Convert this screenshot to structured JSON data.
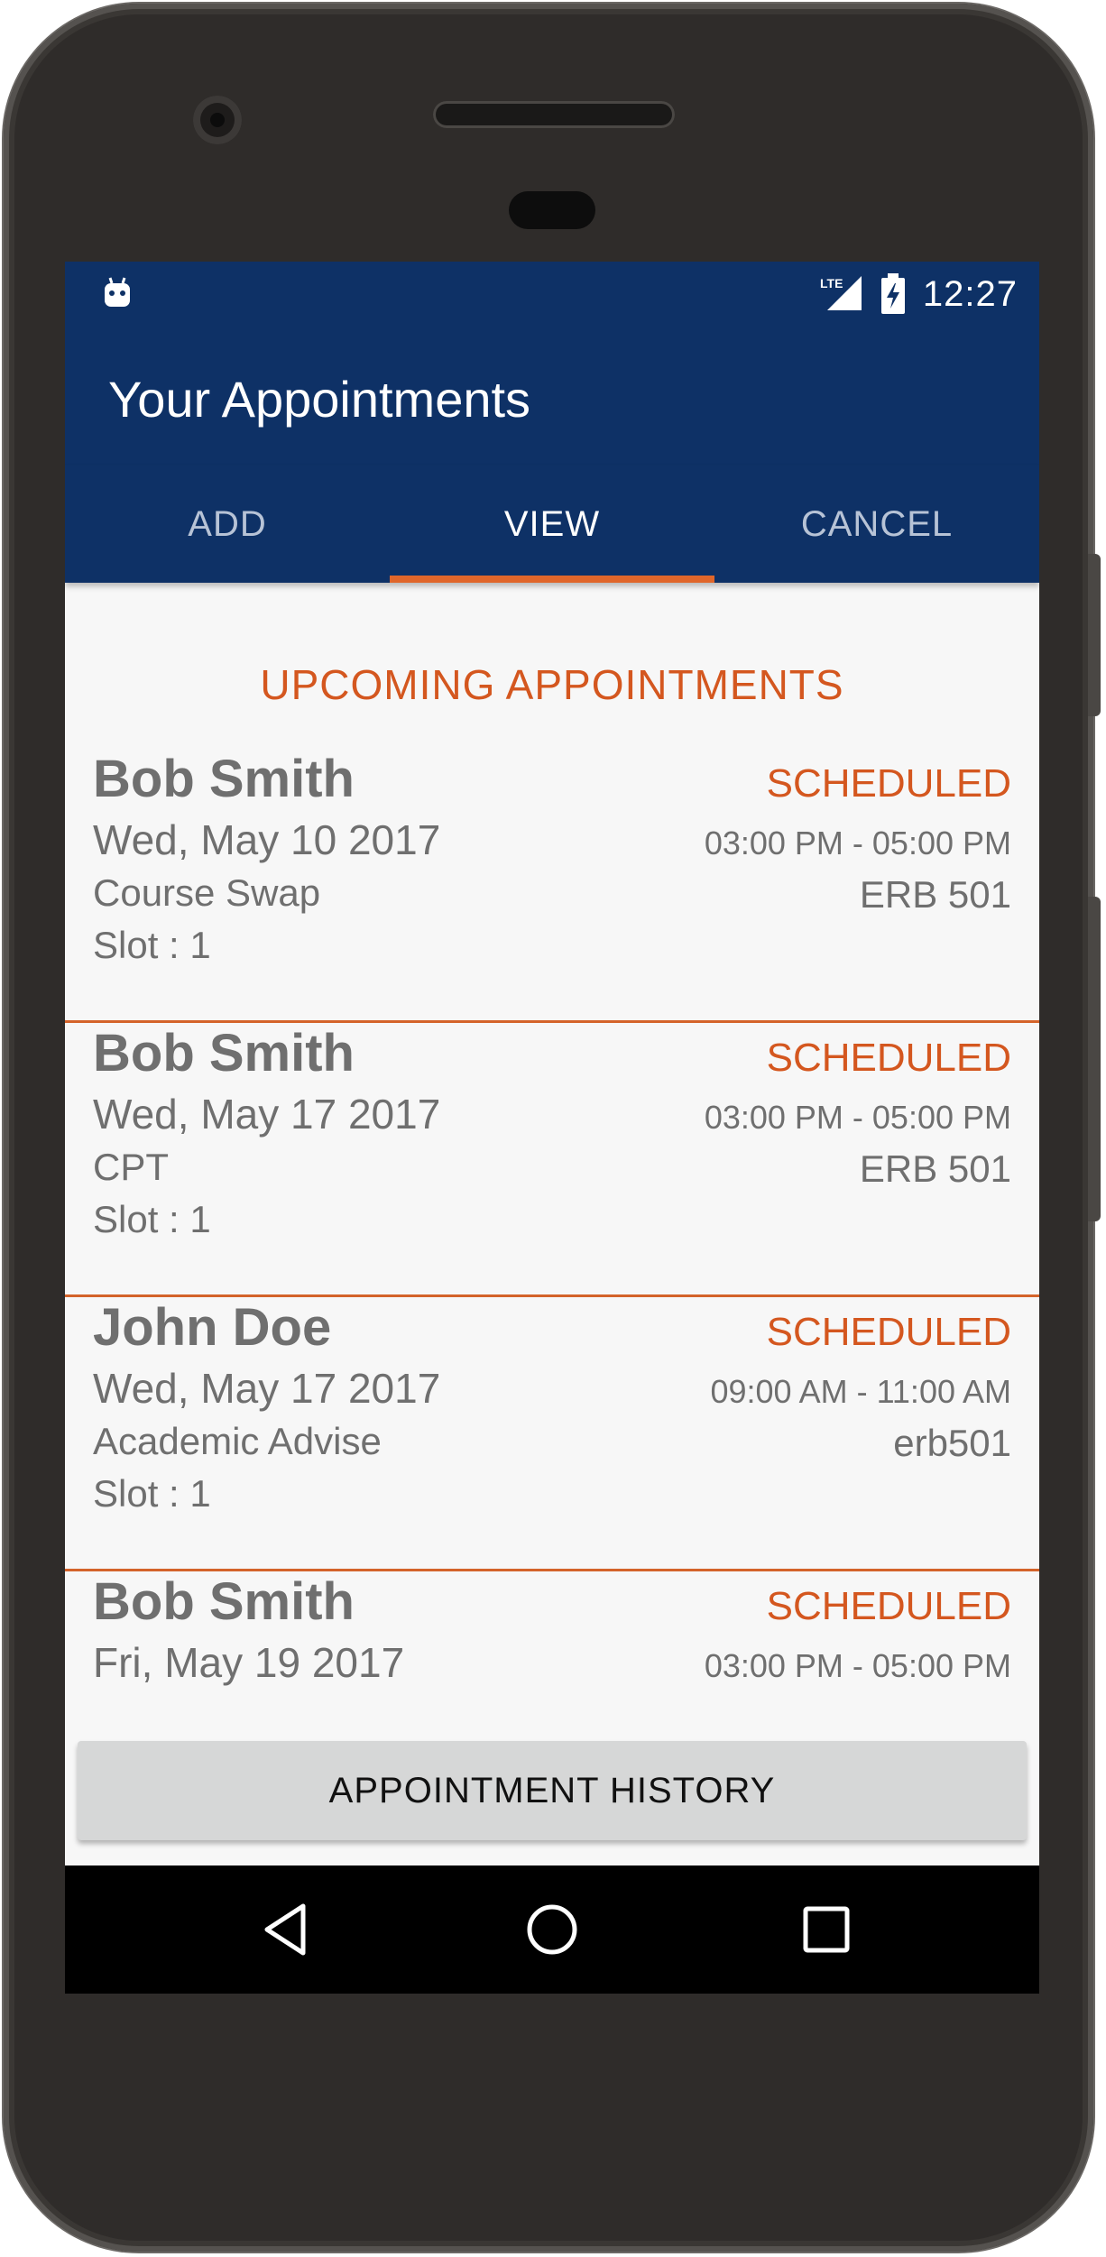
{
  "status_bar": {
    "network": "LTE",
    "time": "12:27"
  },
  "app_bar": {
    "title": "Your Appointments"
  },
  "tabs": [
    {
      "label": "ADD",
      "active": false
    },
    {
      "label": "VIEW",
      "active": true
    },
    {
      "label": "CANCEL",
      "active": false
    }
  ],
  "section": {
    "title": "UPCOMING APPOINTMENTS"
  },
  "appointments": [
    {
      "name": "Bob Smith",
      "date": "Wed, May 10 2017",
      "purpose": "Course Swap",
      "slot": "Slot : 1",
      "status": "SCHEDULED",
      "time": "03:00 PM - 05:00 PM",
      "room": "ERB 501"
    },
    {
      "name": "Bob Smith",
      "date": "Wed, May 17 2017",
      "purpose": "CPT",
      "slot": "Slot : 1",
      "status": "SCHEDULED",
      "time": "03:00 PM - 05:00 PM",
      "room": "ERB 501"
    },
    {
      "name": "John Doe",
      "date": "Wed, May 17 2017",
      "purpose": "Academic Advise",
      "slot": "Slot : 1",
      "status": "SCHEDULED",
      "time": "09:00 AM - 11:00 AM",
      "room": "erb501"
    },
    {
      "name": "Bob Smith",
      "date": "Fri, May 19 2017",
      "purpose": "",
      "slot": "",
      "status": "SCHEDULED",
      "time": "03:00 PM - 05:00 PM",
      "room": ""
    }
  ],
  "history_button": {
    "label": "APPOINTMENT HISTORY"
  },
  "colors": {
    "primary": "#0e3166",
    "accent": "#d4571f",
    "text": "#6f6f6f",
    "background": "#f7f7f7"
  },
  "icons": {
    "status_app": "android-icon",
    "signal": "signal-icon",
    "battery": "battery-charging-icon",
    "nav_back": "back-icon",
    "nav_home": "home-icon",
    "nav_recents": "recents-icon"
  }
}
